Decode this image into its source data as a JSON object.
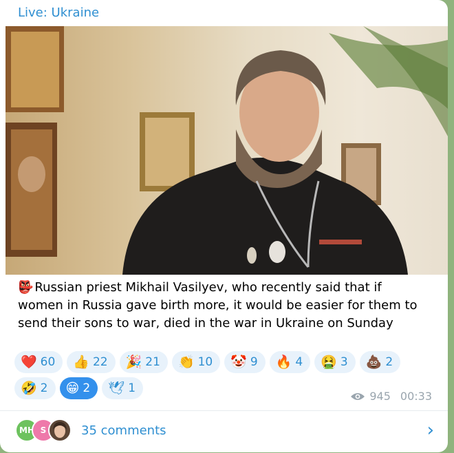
{
  "channel": {
    "title": "Live: Ukraine"
  },
  "post": {
    "caption_emoji": "👺",
    "caption": "Russian priest Mikhail Vasilyev, who recently said that if women in Russia gave birth more, it would be easier for them to send their sons to war, died in the war in Ukraine on Sunday"
  },
  "reactions": [
    {
      "emoji": "❤️",
      "count": "60"
    },
    {
      "emoji": "👍",
      "count": "22"
    },
    {
      "emoji": "🎉",
      "count": "21"
    },
    {
      "emoji": "👏",
      "count": "10"
    },
    {
      "emoji": "🤡",
      "count": "9"
    },
    {
      "emoji": "🔥",
      "count": "4"
    },
    {
      "emoji": "🤮",
      "count": "3"
    },
    {
      "emoji": "💩",
      "count": "2"
    },
    {
      "emoji": "🤣",
      "count": "2"
    },
    {
      "emoji": "😁",
      "count": "2",
      "active": true
    },
    {
      "emoji": "🕊",
      "count": "1"
    }
  ],
  "meta": {
    "views": "945",
    "time": "00:33",
    "views_icon": "eye-icon"
  },
  "comments": {
    "label": "35 comments",
    "avatars": [
      "MH",
      "S",
      ""
    ]
  },
  "colors": {
    "accent": "#2f8fd1",
    "chip_bg": "#e8f2fb",
    "chip_active": "#3390ec"
  }
}
